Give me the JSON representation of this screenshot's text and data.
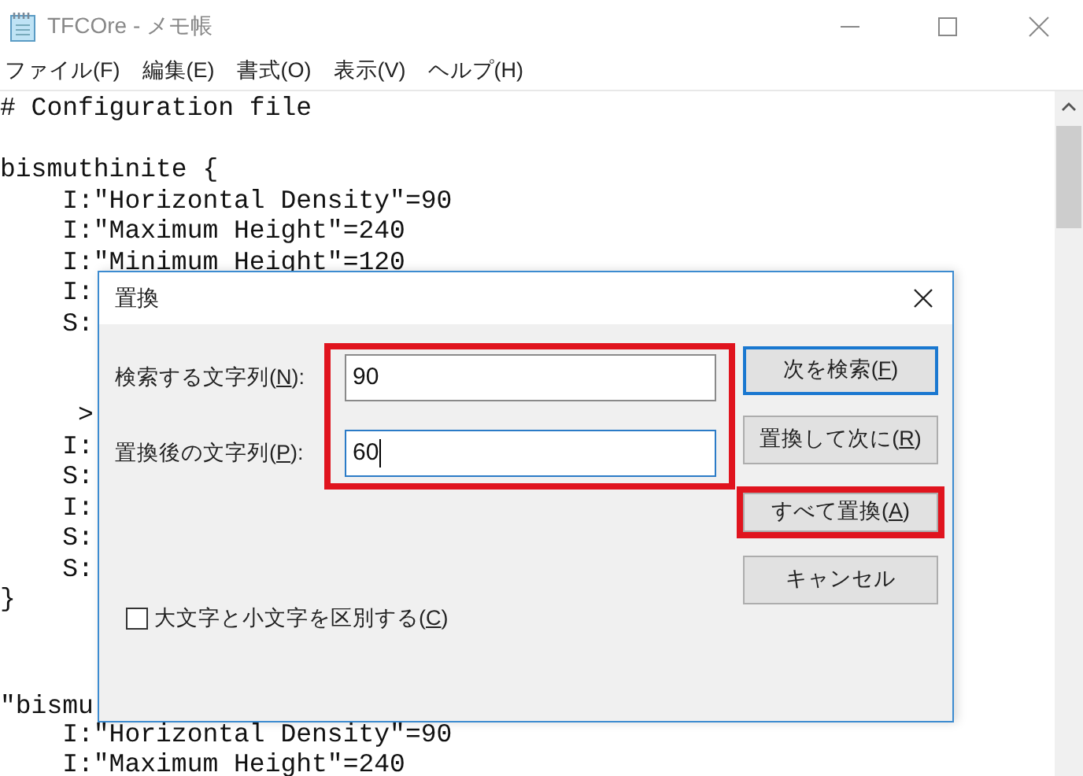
{
  "window": {
    "title": "TFCOre - メモ帳"
  },
  "menu": [
    "ファイル(F)",
    "編集(E)",
    "書式(O)",
    "表示(V)",
    "ヘルプ(H)"
  ],
  "editor": {
    "blocks": [
      {
        "lines": [
          "# Configuration file"
        ]
      },
      {
        "lines": [
          "bismuthinite {",
          "    I:\"Horizontal Density\"=90",
          "    I:\"Maximum Height\"=240",
          "    I:\"Minimum Height\"=120",
          "    I:",
          "    S:"
        ]
      },
      {
        "lines": [
          "     >",
          "    I:",
          "    S:",
          "    I:",
          "    S:",
          "    S:",
          "}"
        ]
      },
      {
        "lines": [
          "\"bismu",
          "    I:\"Horizontal Density\"=90",
          "    I:\"Maximum Height\"=240"
        ]
      }
    ]
  },
  "dialog": {
    "title": "置換",
    "fields": [
      {
        "label": "検索する文字列(N):",
        "value": "90",
        "focused": false
      },
      {
        "label": "置換後の文字列(P):",
        "value": "60",
        "focused": true
      }
    ],
    "buttons": [
      {
        "label": "次を検索(F)",
        "default": true,
        "highlighted": false
      },
      {
        "label": "置換して次に(R)",
        "default": false,
        "highlighted": false
      },
      {
        "label": "すべて置換(A)",
        "default": false,
        "highlighted": true
      },
      {
        "label": "キャンセル",
        "default": false,
        "highlighted": false
      }
    ],
    "checkbox": {
      "label": "大文字と小文字を区別する(C)",
      "checked": false
    },
    "fields_highlighted": true
  }
}
